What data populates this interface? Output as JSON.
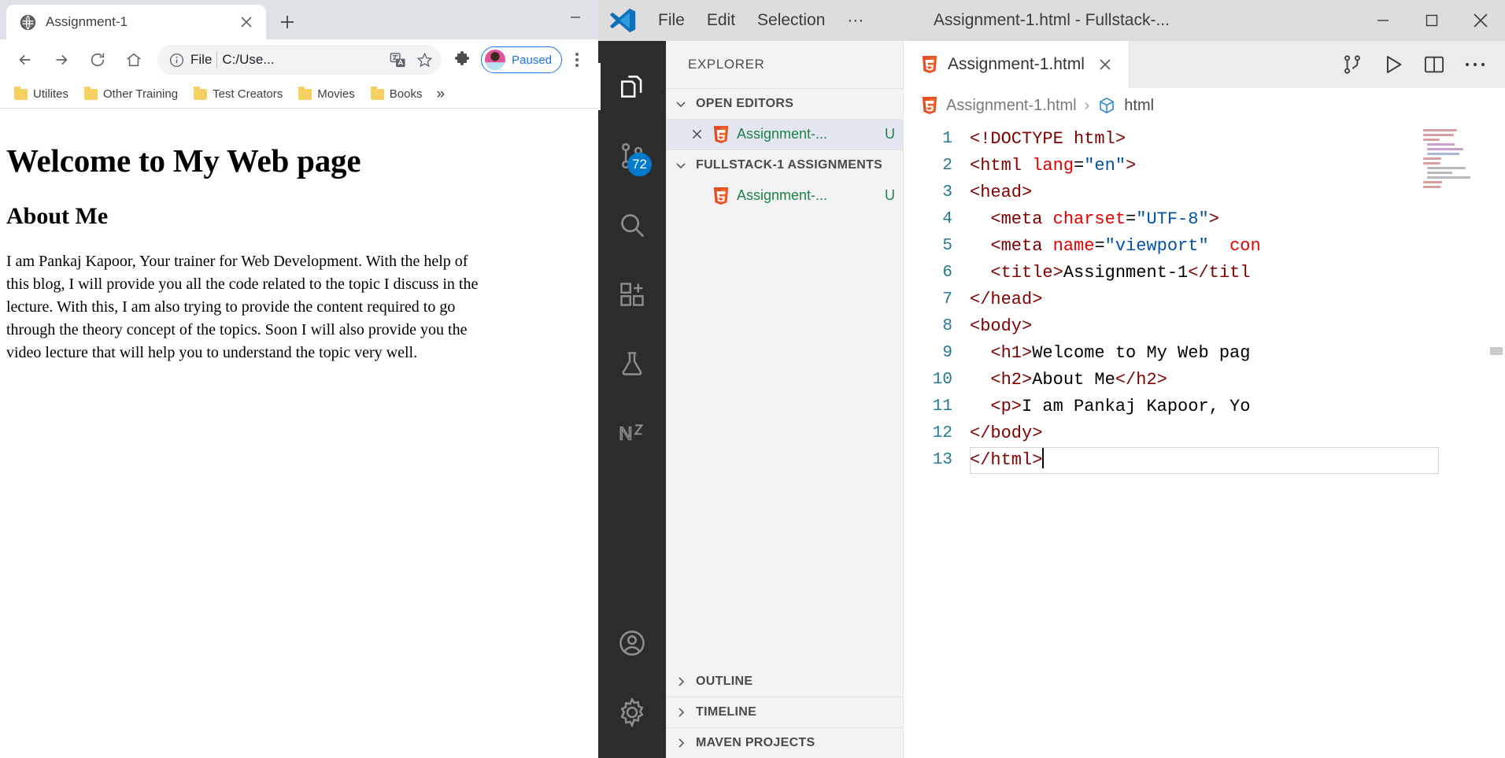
{
  "browser": {
    "tab": {
      "title": "Assignment-1",
      "favicon": "globe-icon",
      "close": "×"
    },
    "new_tab_label": "+",
    "window_controls": {
      "minimize": "─",
      "maximize": "☐",
      "close": "✕"
    },
    "toolbar": {
      "back": "←",
      "forward": "→",
      "reload": "↻",
      "home": "⌂",
      "info_icon": "info-circle-icon",
      "scheme": "File",
      "url": "C:/Use...",
      "translate_icon": "translate-icon",
      "bookmark_icon": "star-icon",
      "extensions_icon": "puzzle-icon",
      "profile_label": "Paused",
      "menu_icon": "kebab-icon"
    },
    "bookmarks": [
      {
        "label": "Utilites"
      },
      {
        "label": "Other Training"
      },
      {
        "label": "Test Creators"
      },
      {
        "label": "Movies"
      },
      {
        "label": "Books"
      }
    ],
    "bookmarks_overflow": "»",
    "page": {
      "h1": "Welcome to My Web page",
      "h2": "About Me",
      "paragraph": "I am Pankaj Kapoor, Your trainer for Web Development. With the help of this blog, I will provide you all the code related to the topic I discuss in the lecture. With this, I am also trying to provide the content required to go through the theory concept of the topics. Soon I will also provide you the video lecture that will help you to understand the topic very well."
    }
  },
  "vscode": {
    "titlebar": {
      "menus": [
        "File",
        "Edit",
        "Selection",
        "···"
      ],
      "title": "Assignment-1.html - Fullstack-...",
      "window_controls": {
        "minimize": "─",
        "maximize": "☐",
        "close": "✕"
      }
    },
    "activitybar": {
      "items": [
        {
          "name": "explorer",
          "icon": "files-icon",
          "active": true,
          "badge": ""
        },
        {
          "name": "source-control",
          "icon": "source-control-icon",
          "active": false,
          "badge": "72"
        },
        {
          "name": "search",
          "icon": "search-icon",
          "active": false,
          "badge": ""
        },
        {
          "name": "extensions",
          "icon": "extensions-icon",
          "active": false,
          "badge": ""
        },
        {
          "name": "testing",
          "icon": "beaker-icon",
          "active": false,
          "badge": ""
        },
        {
          "name": "notebook",
          "icon": "n-squared-icon",
          "active": false,
          "badge": ""
        },
        {
          "name": "accounts",
          "icon": "account-icon",
          "active": false,
          "badge": ""
        },
        {
          "name": "settings",
          "icon": "gear-icon",
          "active": false,
          "badge": ""
        }
      ]
    },
    "sidebar": {
      "title": "EXPLORER",
      "panes": [
        {
          "label": "OPEN EDITORS",
          "expanded": true
        },
        {
          "label": "FULLSTACK-1 ASSIGNMENTS",
          "expanded": true
        },
        {
          "label": "OUTLINE",
          "expanded": false
        },
        {
          "label": "TIMELINE",
          "expanded": false
        },
        {
          "label": "MAVEN PROJECTS",
          "expanded": false
        }
      ],
      "open_editors": [
        {
          "name": "Assignment-...",
          "badge": "U",
          "icon": "html5-icon",
          "selected": true
        }
      ],
      "folder_files": [
        {
          "name": "Assignment-...",
          "badge": "U",
          "icon": "html5-icon",
          "selected": false
        }
      ]
    },
    "editor": {
      "tab": {
        "name": "Assignment-1.html",
        "icon": "html5-icon",
        "close": "✕"
      },
      "actions": [
        {
          "name": "split-compare",
          "icon": "compare-icon"
        },
        {
          "name": "run",
          "icon": "play-icon"
        },
        {
          "name": "split-editor",
          "icon": "split-editor-icon"
        },
        {
          "name": "more-actions",
          "icon": "ellipsis-icon"
        }
      ],
      "breadcrumbs": [
        "Assignment-1.html",
        "html"
      ],
      "breadcrumb_sep": "›",
      "code_lines": [
        {
          "n": "1",
          "tokens": [
            {
              "t": "tag",
              "v": "<!DOCTYPE html>"
            }
          ]
        },
        {
          "n": "2",
          "tokens": [
            {
              "t": "tag",
              "v": "<html "
            },
            {
              "t": "attr",
              "v": "lang"
            },
            {
              "t": "txt",
              "v": "="
            },
            {
              "t": "str",
              "v": "\"en\""
            },
            {
              "t": "tag",
              "v": ">"
            }
          ]
        },
        {
          "n": "3",
          "tokens": [
            {
              "t": "tag",
              "v": "<head>"
            }
          ]
        },
        {
          "n": "4",
          "tokens": [
            {
              "t": "txt",
              "v": "  "
            },
            {
              "t": "tag",
              "v": "<meta "
            },
            {
              "t": "attr",
              "v": "charset"
            },
            {
              "t": "txt",
              "v": "="
            },
            {
              "t": "str",
              "v": "\"UTF-8\""
            },
            {
              "t": "tag",
              "v": ">"
            }
          ]
        },
        {
          "n": "5",
          "tokens": [
            {
              "t": "txt",
              "v": "  "
            },
            {
              "t": "tag",
              "v": "<meta "
            },
            {
              "t": "attr",
              "v": "name"
            },
            {
              "t": "txt",
              "v": "="
            },
            {
              "t": "str",
              "v": "\"viewport\""
            },
            {
              "t": "txt",
              "v": "  "
            },
            {
              "t": "attr",
              "v": "con"
            }
          ]
        },
        {
          "n": "6",
          "tokens": [
            {
              "t": "txt",
              "v": "  "
            },
            {
              "t": "tag",
              "v": "<title>"
            },
            {
              "t": "txt",
              "v": "Assignment-1"
            },
            {
              "t": "tag",
              "v": "</titl"
            }
          ]
        },
        {
          "n": "7",
          "tokens": [
            {
              "t": "tag",
              "v": "</head>"
            }
          ]
        },
        {
          "n": "8",
          "tokens": [
            {
              "t": "tag",
              "v": "<body>"
            }
          ]
        },
        {
          "n": "9",
          "tokens": [
            {
              "t": "txt",
              "v": "  "
            },
            {
              "t": "tag",
              "v": "<h1>"
            },
            {
              "t": "txt",
              "v": "Welcome to My Web pag"
            }
          ]
        },
        {
          "n": "10",
          "tokens": [
            {
              "t": "txt",
              "v": "  "
            },
            {
              "t": "tag",
              "v": "<h2>"
            },
            {
              "t": "txt",
              "v": "About Me"
            },
            {
              "t": "tag",
              "v": "</h2>"
            }
          ]
        },
        {
          "n": "11",
          "tokens": [
            {
              "t": "txt",
              "v": "  "
            },
            {
              "t": "tag",
              "v": "<p>"
            },
            {
              "t": "txt",
              "v": "I am Pankaj Kapoor, Yo"
            }
          ]
        },
        {
          "n": "12",
          "tokens": [
            {
              "t": "tag",
              "v": "</body>"
            }
          ]
        },
        {
          "n": "13",
          "tokens": [
            {
              "t": "tag",
              "v": "</html>"
            }
          ],
          "cursor": true
        }
      ]
    }
  }
}
